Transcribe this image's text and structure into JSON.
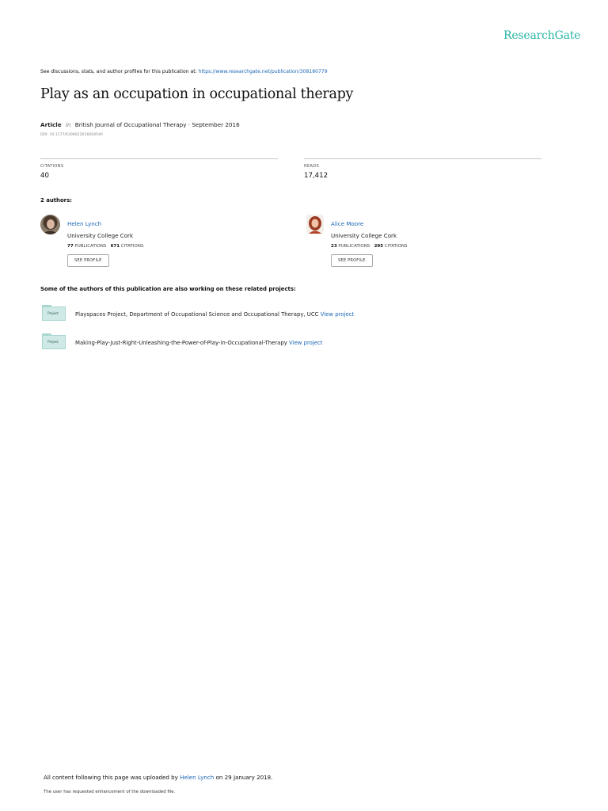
{
  "brand": {
    "logo_text": "ResearchGate",
    "logo_color": "#2ab6a6",
    "link_color": "#1a66b5"
  },
  "header": {
    "intro_text": "See discussions, stats, and author profiles for this publication at: ",
    "publication_url": "https://www.researchgate.net/publication/308180779"
  },
  "publication": {
    "title": "Play as an occupation in occupational therapy",
    "type": "Article",
    "in_text": "in",
    "journal_date": "British Journal of Occupational Therapy · September 2016",
    "doi": "DOI: 10.1177/0308022616664540"
  },
  "stats": {
    "citations_label": "CITATIONS",
    "citations_value": "40",
    "reads_label": "READS",
    "reads_value": "17,412"
  },
  "authors_heading": "2 authors:",
  "authors": [
    {
      "name": "Helen Lynch",
      "institution": "University College Cork",
      "publications": "77",
      "publications_label": "PUBLICATIONS",
      "citations": "671",
      "citations_label": "CITATIONS",
      "button_label": "SEE PROFILE"
    },
    {
      "name": "Alice Moore",
      "institution": "University College Cork",
      "publications": "23",
      "publications_label": "PUBLICATIONS",
      "citations": "295",
      "citations_label": "CITATIONS",
      "button_label": "SEE PROFILE"
    }
  ],
  "related_heading": "Some of the authors of this publication are also working on these related projects:",
  "projects": [
    {
      "icon_label": "Project",
      "title": "Playspaces Project, Department of Occupational Science and Occupational Therapy, UCC",
      "link_label": "View project"
    },
    {
      "icon_label": "Project",
      "title": "Making-Play-Just-Right-Unleashing-the-Power-of-Play-in-Occupational-Therapy",
      "link_label": "View project"
    }
  ],
  "footer": {
    "uploaded_prefix": "All content following this page was uploaded by ",
    "uploader": "Helen Lynch",
    "uploaded_suffix": " on 29 January 2018.",
    "note": "The user has requested enhancement of the downloaded file."
  }
}
